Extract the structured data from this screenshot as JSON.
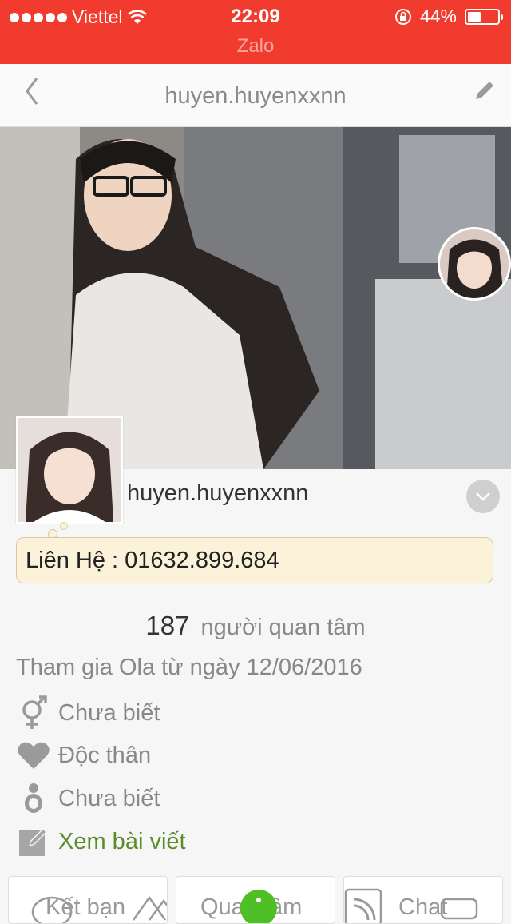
{
  "status_bar": {
    "carrier": "Viettel",
    "time": "22:09",
    "battery": "44%",
    "battery_level": 0.44,
    "app_name": "Zalo"
  },
  "nav": {
    "back_icon": "chevron-left-icon",
    "title": "huyen.huyenxxnn",
    "edit_icon": "pencil-icon"
  },
  "profile": {
    "username": "huyen.huyenxxnn",
    "contact": "Liên Hệ : 01632.899.684",
    "followers_count": "187",
    "followers_label": "người quan tâm",
    "joined": "Tham gia Ola từ ngày 12/06/2016",
    "gender": "Chưa biết",
    "relationship": "Độc thân",
    "children": "Chưa biết",
    "posts_link": "Xem bài viết"
  },
  "bottom_bar": {
    "add_friend": "Kết bạn",
    "follow": "Quan tâm",
    "chat": "Chat"
  },
  "colors": {
    "status_bar": "#f13b2f",
    "posts_link": "#5b8c2a",
    "contact_bubble": "#fbf2d9"
  }
}
